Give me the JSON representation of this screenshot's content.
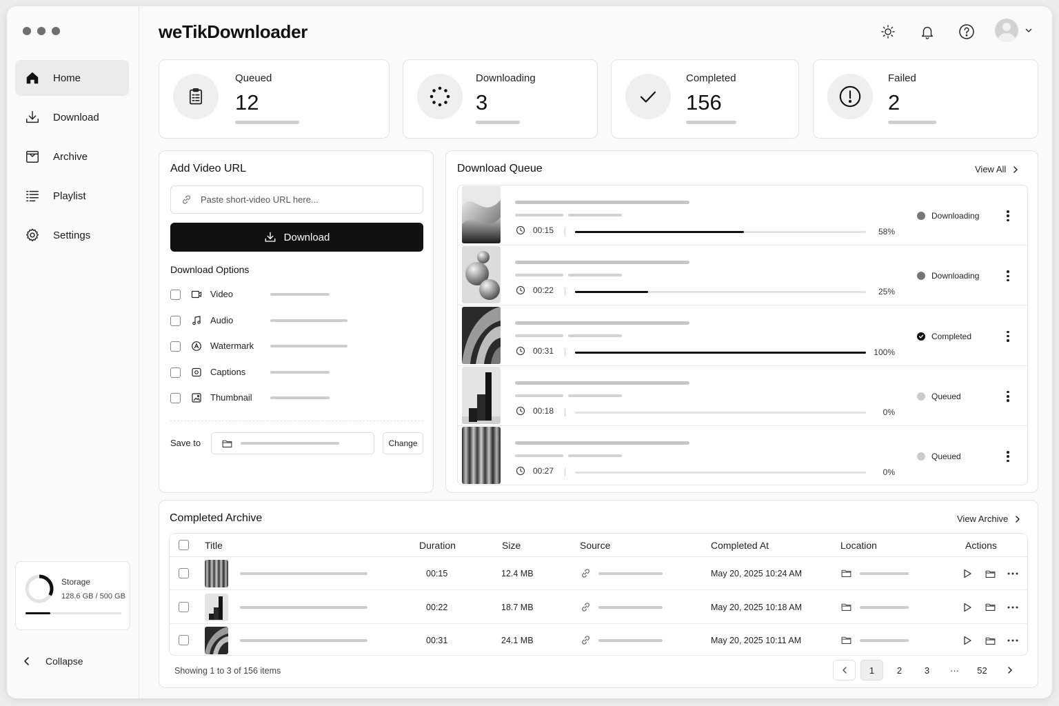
{
  "app": {
    "title": "weTikDownloader"
  },
  "sidebar": {
    "items": [
      {
        "label": "Home",
        "icon": "home-icon",
        "active": true
      },
      {
        "label": "Download",
        "icon": "download-icon"
      },
      {
        "label": "Archive",
        "icon": "archive-icon"
      },
      {
        "label": "Playlist",
        "icon": "playlist-icon"
      },
      {
        "label": "Settings",
        "icon": "gear-icon"
      }
    ],
    "storage": {
      "label": "Storage",
      "value": "128.6 GB / 500 GB",
      "used_fraction": 0.257
    },
    "collapse_label": "Collapse"
  },
  "header": {
    "icons": [
      "sun-icon",
      "bell-icon",
      "help-icon",
      "avatar",
      "chevron-down-icon"
    ]
  },
  "stats": [
    {
      "label": "Queued",
      "value": "12",
      "icon": "clipboard-icon"
    },
    {
      "label": "Downloading",
      "value": "3",
      "icon": "spinner-icon"
    },
    {
      "label": "Completed",
      "value": "156",
      "icon": "check-icon"
    },
    {
      "label": "Failed",
      "value": "2",
      "icon": "alert-icon"
    }
  ],
  "add_url": {
    "title": "Add Video URL",
    "placeholder": "Paste short-video URL here...",
    "download_label": "Download",
    "options_title": "Download Options",
    "options": [
      {
        "label": "Video",
        "icon": "video-icon",
        "checked": false
      },
      {
        "label": "Audio",
        "icon": "music-icon",
        "checked": false
      },
      {
        "label": "Watermark",
        "icon": "watermark-icon",
        "checked": false
      },
      {
        "label": "Captions",
        "icon": "captions-icon",
        "checked": false
      },
      {
        "label": "Thumbnail",
        "icon": "image-icon",
        "checked": false
      }
    ],
    "save_to_label": "Save to",
    "change_label": "Change"
  },
  "queue": {
    "title": "Download Queue",
    "view_all_label": "View All",
    "items": [
      {
        "duration": "00:15",
        "progress": 0.58,
        "percent_label": "58%",
        "status": "Downloading"
      },
      {
        "duration": "00:22",
        "progress": 0.25,
        "percent_label": "25%",
        "status": "Downloading"
      },
      {
        "duration": "00:31",
        "progress": 1.0,
        "percent_label": "100%",
        "status": "Completed"
      },
      {
        "duration": "00:18",
        "progress": 0,
        "percent_label": "0%",
        "status": "Queued"
      },
      {
        "duration": "00:27",
        "progress": 0,
        "percent_label": "0%",
        "status": "Queued"
      }
    ]
  },
  "archive": {
    "title": "Completed Archive",
    "view_archive_label": "View Archive",
    "columns": [
      "Title",
      "Duration",
      "Size",
      "Source",
      "Completed At",
      "Location",
      "Actions"
    ],
    "rows": [
      {
        "duration": "00:15",
        "size": "12.4 MB",
        "completed_at": "May 20, 2025 10:24 AM"
      },
      {
        "duration": "00:22",
        "size": "18.7 MB",
        "completed_at": "May 20, 2025 10:18 AM"
      },
      {
        "duration": "00:31",
        "size": "24.1 MB",
        "completed_at": "May 20, 2025 10:11 AM"
      }
    ],
    "showing": "Showing 1 to 3 of 156 items",
    "pages": [
      "1",
      "2",
      "3",
      "···",
      "52"
    ],
    "current_page": "1"
  },
  "colors": {
    "accent": "#111111",
    "status_downloading": "#777777",
    "status_completed": "#111111",
    "status_queued": "#cccccc"
  }
}
